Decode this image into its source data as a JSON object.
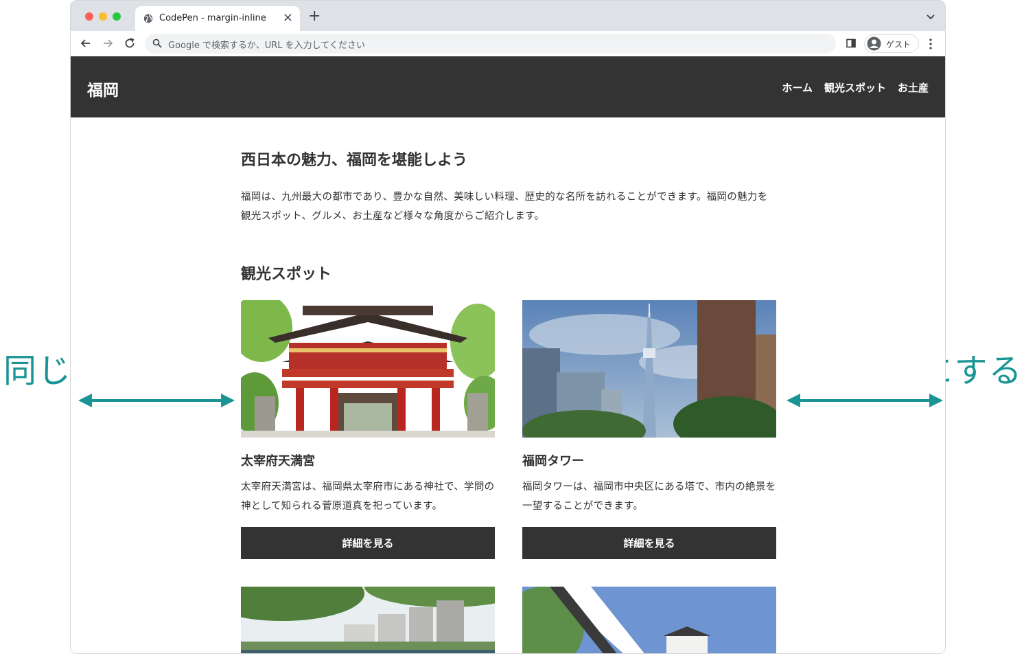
{
  "browser": {
    "tab_title": "CodePen - margin-inline",
    "omnibox_placeholder": "Google で検索するか、URL を入力してください",
    "profile_label": "ゲスト"
  },
  "site": {
    "logo": "福岡",
    "nav": [
      "ホーム",
      "観光スポット",
      "お土産"
    ]
  },
  "hero": {
    "title": "西日本の魅力、福岡を堪能しよう",
    "text": "福岡は、九州最大の都市であり、豊かな自然、美味しい料理、歴史的な名所を訪れることができます。福岡の魅力を観光スポット、グルメ、お土産など様々な角度からご紹介します。"
  },
  "spots": {
    "title": "観光スポット",
    "cards": [
      {
        "title": "太宰府天満宮",
        "text": "太宰府天満宮は、福岡県太宰府市にある神社で、学問の神として知られる菅原道真を祀っています。",
        "button": "詳細を見る"
      },
      {
        "title": "福岡タワー",
        "text": "福岡タワーは、福岡市中央区にある塔で、市内の絶景を一望することができます。",
        "button": "詳細を見る"
      }
    ]
  },
  "annotation": {
    "label": "同じ幅にする",
    "color": "#1a9494"
  },
  "colors": {
    "header_bg": "#333333",
    "button_bg": "#333333"
  }
}
